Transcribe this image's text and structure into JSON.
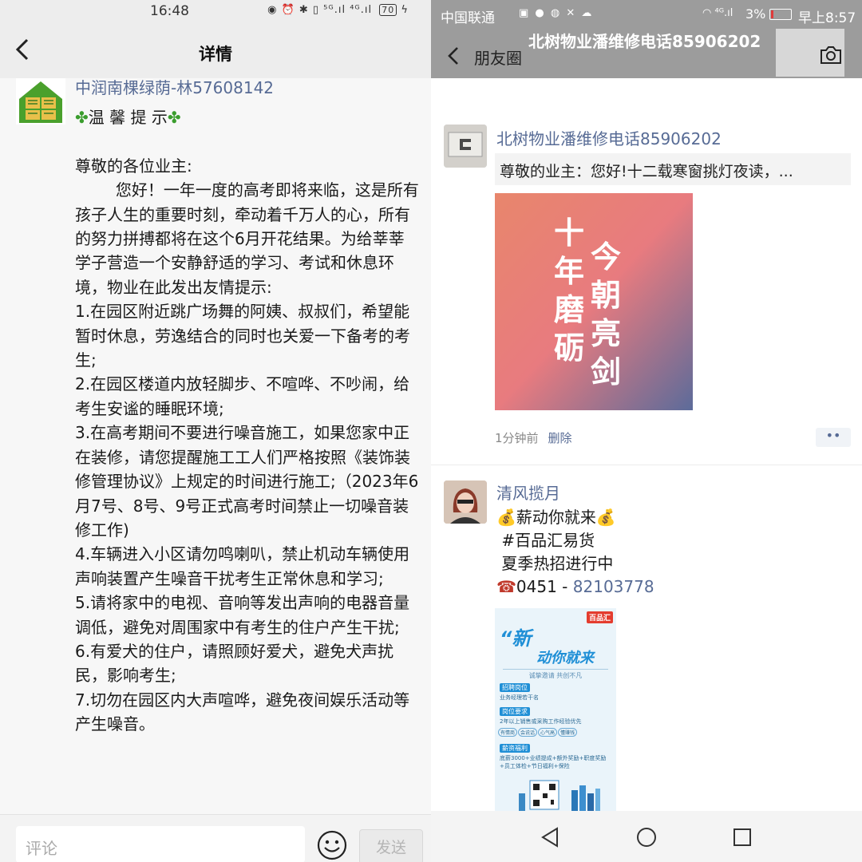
{
  "left": {
    "status_time": "16:48",
    "status_icons": "◉ ⏰ ✱ ▯ ⁵ᴳ.ıl ⁴ᴳ.ıl",
    "battery": "70",
    "title": "详情",
    "poster_name": "中润南棵绿荫-林57608142",
    "heading": "温 馨 提 示",
    "paragraphs": [
      "尊敬的各位业主:",
      "",
      "        您好！一年一度的高考即将来临，这是所有孩子人生的重要时刻，牵动着千万人的心，所有的努力拼搏都将在这个6月开花结果。为给莘莘学子营造一个安静舒适的学习、考试和休息环境，物业在此发出友情提示:",
      "1.在园区附近跳广场舞的阿姨、叔叔们，希望能暂时休息，劳逸结合的同时也关爱一下备考的考生;",
      "2.在园区楼道内放轻脚步、不喧哗、不吵闹，给考生安谧的睡眠环境;",
      "3.在高考期间不要进行噪音施工，如果您家中正在装修，请您提醒施工工人们严格按照《装饰装修管理协议》上规定的时间进行施工;（2023年6月7号、8号、9号正式高考时间禁止一切噪音装修工作)",
      "4.车辆进入小区请勿鸣喇叭，禁止机动车辆使用声响装置产生噪音干扰考生正常休息和学习;",
      "5.请将家中的电视、音响等发出声响的电器音量调低，避免对周围家中有考生的住户产生干扰;",
      "6.有爱犬的住户，请照顾好爱犬，避免犬声扰民，影响考生;",
      "7.切勿在园区内大声喧哗，避免夜间娱乐活动等产生噪音。"
    ],
    "comment_placeholder": "评论",
    "send_label": "发送"
  },
  "right": {
    "carrier": "中国联通",
    "signal": "⁴ᴳ.ıl",
    "battery_pct": "3%",
    "time": "早上8:57",
    "overlay_title": "北树物业潘维修电话85906202",
    "nav_label": "朋友圈",
    "post1": {
      "name": "北树物业潘维修电话85906202",
      "share_text": "尊敬的业主：您好!十二载寒窗挑灯夜读，...",
      "poster_line1": "十年磨砺",
      "poster_line2": "今朝亮剑",
      "time": "1分钟前",
      "delete": "删除",
      "more": "••"
    },
    "post2": {
      "name": "清风揽月",
      "lines": [
        "薪动你就来",
        "#百品汇易货",
        "夏季热招进行中"
      ],
      "phone_prefix": "0451 - ",
      "phone_number": "82103778",
      "flyer": {
        "brand": "百品汇",
        "headline_a": "“新",
        "headline_b": "动你就来",
        "slogan": "诚挚邀请 共创不凡",
        "sec1": "招聘岗位",
        "sec1_text": "业务经理若干名",
        "sec2": "岗位要求",
        "sec2_text": "2年以上销售或采购工作经验优先",
        "tags": [
          "有情商",
          "会说话",
          "心气高",
          "懂赚钱"
        ],
        "sec3": "薪资福利",
        "sec3_text": "底薪3000+业绩提成+额外奖励+职度奖励+员工体检+节日福利+保险"
      }
    }
  }
}
